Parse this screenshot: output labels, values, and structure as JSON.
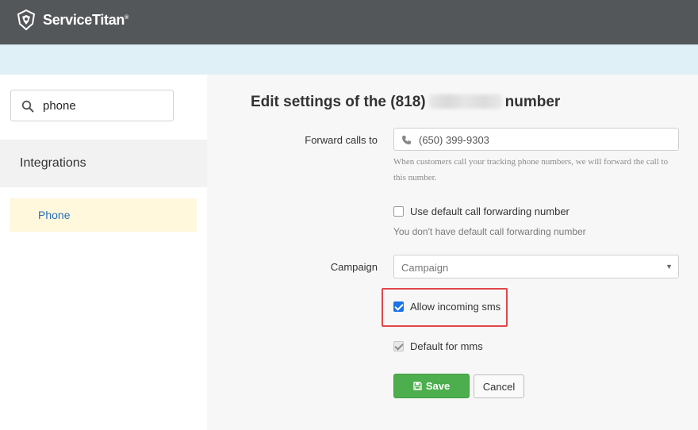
{
  "app": {
    "brand": "ServiceTitan",
    "brand_tm": "®",
    "logo_icon": "servicetitan-logo-icon"
  },
  "sidebar": {
    "search": {
      "value": "phone",
      "icon": "search-icon"
    },
    "section": {
      "label": "Integrations"
    },
    "items": [
      {
        "label": "Phone",
        "active": true
      }
    ]
  },
  "form": {
    "title_prefix": "Edit settings of the (818)",
    "title_suffix": "number",
    "forward": {
      "label": "Forward calls to",
      "value": "(650) 399-9303",
      "icon": "phone-icon",
      "help": "When customers call your tracking phone numbers, we will forward the call to this number."
    },
    "use_default": {
      "label": "Use default call forwarding number",
      "checked": false,
      "note": "You don't have default call forwarding number"
    },
    "campaign": {
      "label": "Campaign",
      "placeholder": "Campaign",
      "icon": "caret-down-icon"
    },
    "allow_sms": {
      "label": "Allow incoming sms",
      "checked": true
    },
    "default_mms": {
      "label": "Default for mms",
      "checked": true,
      "disabled": true
    },
    "buttons": {
      "save": {
        "label": "Save",
        "icon": "save-icon"
      },
      "cancel": {
        "label": "Cancel"
      }
    }
  },
  "colors": {
    "header_bg": "#54575a",
    "banner_bg": "#dff0f7",
    "save_green": "#4cae4c",
    "link_blue": "#2a6ebb",
    "highlight_red": "#e0474c",
    "active_item_bg": "#fff8dc"
  }
}
